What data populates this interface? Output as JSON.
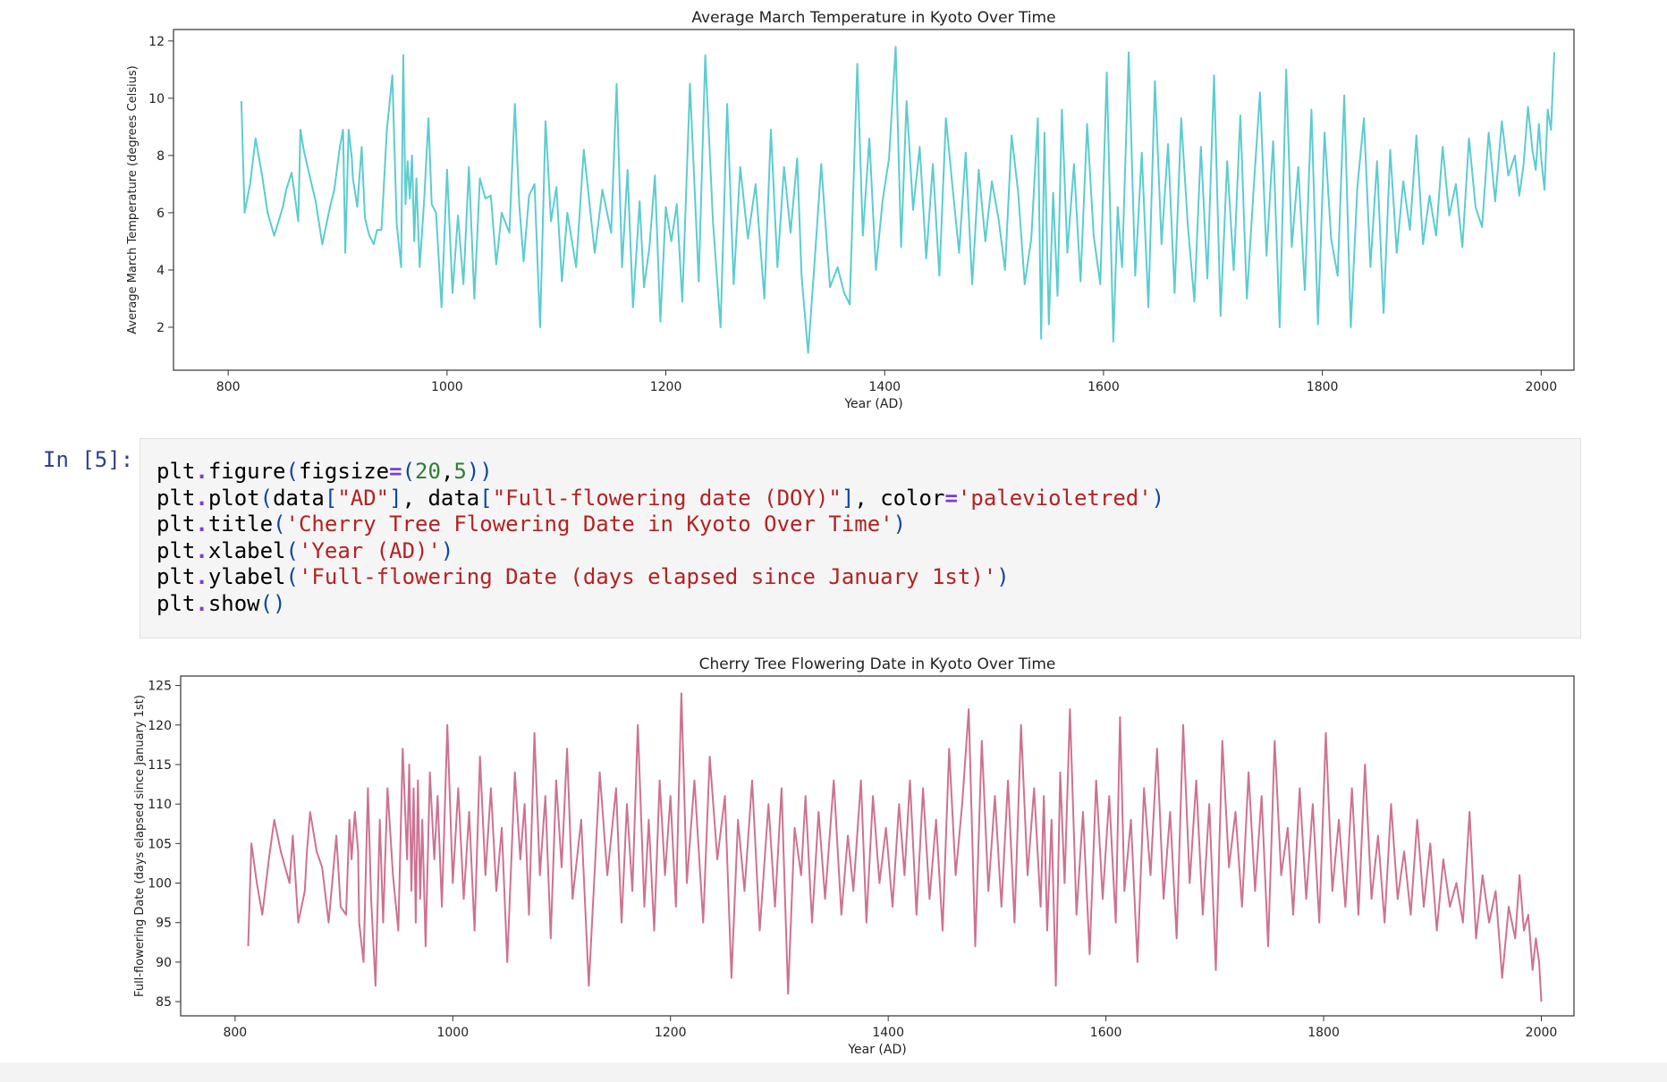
{
  "prompt": "In [5]:",
  "code_lines": [
    [
      {
        "t": "plt"
      },
      {
        "t": ".",
        "c": "op"
      },
      {
        "t": "figure"
      },
      {
        "t": "(",
        "c": "par"
      },
      {
        "t": "figsize"
      },
      {
        "t": "=",
        "c": "op"
      },
      {
        "t": "(",
        "c": "par"
      },
      {
        "t": "20",
        "c": "num"
      },
      {
        "t": ","
      },
      {
        "t": "5",
        "c": "num"
      },
      {
        "t": "))",
        "c": "par"
      }
    ],
    [
      {
        "t": "plt"
      },
      {
        "t": ".",
        "c": "op"
      },
      {
        "t": "plot"
      },
      {
        "t": "(",
        "c": "par"
      },
      {
        "t": "data"
      },
      {
        "t": "[",
        "c": "par"
      },
      {
        "t": "\"AD\"",
        "c": "str"
      },
      {
        "t": "]",
        "c": "par"
      },
      {
        "t": ", data"
      },
      {
        "t": "[",
        "c": "par"
      },
      {
        "t": "\"Full-flowering date (DOY)\"",
        "c": "str"
      },
      {
        "t": "]",
        "c": "par"
      },
      {
        "t": ", color"
      },
      {
        "t": "=",
        "c": "op"
      },
      {
        "t": "'palevioletred'",
        "c": "str"
      },
      {
        "t": ")",
        "c": "par"
      }
    ],
    [
      {
        "t": "plt"
      },
      {
        "t": ".",
        "c": "op"
      },
      {
        "t": "title"
      },
      {
        "t": "(",
        "c": "par"
      },
      {
        "t": "'Cherry Tree Flowering Date in Kyoto Over Time'",
        "c": "str"
      },
      {
        "t": ")",
        "c": "par"
      }
    ],
    [
      {
        "t": "plt"
      },
      {
        "t": ".",
        "c": "op"
      },
      {
        "t": "xlabel"
      },
      {
        "t": "(",
        "c": "par"
      },
      {
        "t": "'Year (AD)'",
        "c": "str"
      },
      {
        "t": ")",
        "c": "par"
      }
    ],
    [
      {
        "t": "plt"
      },
      {
        "t": ".",
        "c": "op"
      },
      {
        "t": "ylabel"
      },
      {
        "t": "(",
        "c": "par"
      },
      {
        "t": "'Full-flowering Date (days elapsed since January 1st)'",
        "c": "str"
      },
      {
        "t": ")",
        "c": "par"
      }
    ],
    [
      {
        "t": "plt"
      },
      {
        "t": ".",
        "c": "op"
      },
      {
        "t": "show"
      },
      {
        "t": "()",
        "c": "par"
      }
    ]
  ],
  "colors": {
    "line1": "#5ccccf",
    "line2": "#cc7293",
    "axes": "#333333",
    "text": "#222222"
  },
  "chart_data": [
    {
      "type": "line",
      "title": "Average March Temperature in Kyoto Over Time",
      "xlabel": "Year (AD)",
      "ylabel": "Average March Temperature (degrees Celsius)",
      "xlim": [
        750,
        2030
      ],
      "ylim": [
        0.5,
        12.4
      ],
      "xticks": [
        800,
        1000,
        1200,
        1400,
        1600,
        1800,
        2000
      ],
      "yticks": [
        2,
        4,
        6,
        8,
        10,
        12
      ],
      "color": "#5ccccf",
      "x": [
        812,
        815,
        820,
        825,
        831,
        836,
        842,
        850,
        853,
        858,
        864,
        866,
        869,
        875,
        880,
        886,
        893,
        897,
        902,
        905,
        907,
        910,
        913,
        914,
        918,
        922,
        925,
        929,
        933,
        936,
        940,
        945,
        950,
        954,
        958,
        960,
        962,
        964,
        966,
        968,
        970,
        972,
        975,
        979,
        983,
        986,
        990,
        995,
        1000,
        1005,
        1010,
        1015,
        1020,
        1025,
        1030,
        1035,
        1040,
        1045,
        1050,
        1057,
        1062,
        1066,
        1070,
        1075,
        1080,
        1085,
        1090,
        1095,
        1100,
        1105,
        1110,
        1118,
        1125,
        1135,
        1142,
        1150,
        1155,
        1160,
        1165,
        1170,
        1176,
        1180,
        1185,
        1190,
        1195,
        1200,
        1205,
        1210,
        1215,
        1222,
        1230,
        1236,
        1243,
        1250,
        1256,
        1262,
        1268,
        1275,
        1282,
        1290,
        1296,
        1302,
        1308,
        1314,
        1320,
        1324,
        1330,
        1336,
        1342,
        1350,
        1357,
        1363,
        1368,
        1375,
        1380,
        1386,
        1392,
        1398,
        1404,
        1410,
        1415,
        1420,
        1426,
        1432,
        1438,
        1444,
        1450,
        1456,
        1462,
        1468,
        1474,
        1480,
        1486,
        1492,
        1498,
        1504,
        1510,
        1516,
        1522,
        1528,
        1534,
        1540,
        1543,
        1546,
        1550,
        1554,
        1558,
        1562,
        1567,
        1573,
        1579,
        1585,
        1591,
        1597,
        1603,
        1609,
        1613,
        1617,
        1623,
        1629,
        1635,
        1641,
        1647,
        1653,
        1659,
        1665,
        1671,
        1677,
        1683,
        1689,
        1695,
        1701,
        1707,
        1713,
        1719,
        1725,
        1731,
        1737,
        1743,
        1749,
        1755,
        1761,
        1767,
        1772,
        1778,
        1784,
        1790,
        1796,
        1802,
        1808,
        1814,
        1820,
        1826,
        1832,
        1838,
        1844,
        1850,
        1856,
        1862,
        1868,
        1874,
        1880,
        1886,
        1892,
        1898,
        1904,
        1910,
        1916,
        1922,
        1928,
        1934,
        1940,
        1946,
        1952,
        1958,
        1964,
        1970,
        1976,
        1980,
        1984,
        1988,
        1992,
        1995,
        1998,
        2000,
        2003,
        2006,
        2009,
        2012,
        2015,
        2018,
        2021
      ],
      "y": [
        9.9,
        6.0,
        7.0,
        8.6,
        7.3,
        6.0,
        5.2,
        6.2,
        6.8,
        7.4,
        5.7,
        8.9,
        8.2,
        7.2,
        6.4,
        4.9,
        6.2,
        6.8,
        8.3,
        8.9,
        4.6,
        8.9,
        7.9,
        7.2,
        6.2,
        8.3,
        5.8,
        5.2,
        4.9,
        5.4,
        5.4,
        8.9,
        10.8,
        5.6,
        4.1,
        11.5,
        6.3,
        7.8,
        6.5,
        8.0,
        5.0,
        7.2,
        4.1,
        6.4,
        9.3,
        6.3,
        6.0,
        2.7,
        7.5,
        3.2,
        5.9,
        3.5,
        7.6,
        3.0,
        7.2,
        6.5,
        6.6,
        4.2,
        6.0,
        5.3,
        9.8,
        6.3,
        4.3,
        6.6,
        7.0,
        2.0,
        9.2,
        5.7,
        6.9,
        3.6,
        6.0,
        4.1,
        8.2,
        4.6,
        6.8,
        5.3,
        10.5,
        4.1,
        7.5,
        2.7,
        6.4,
        3.4,
        4.8,
        7.3,
        2.2,
        6.2,
        5.0,
        6.3,
        2.9,
        10.5,
        3.6,
        11.5,
        5.7,
        2.0,
        9.8,
        3.5,
        7.6,
        5.1,
        7.0,
        3.0,
        8.9,
        4.1,
        7.6,
        5.3,
        7.9,
        3.8,
        1.1,
        4.3,
        7.7,
        3.4,
        4.1,
        3.2,
        2.8,
        11.2,
        5.2,
        8.6,
        4.0,
        6.4,
        7.9,
        11.8,
        4.8,
        9.9,
        6.1,
        8.3,
        4.4,
        7.7,
        3.8,
        9.3,
        6.9,
        4.6,
        8.1,
        3.5,
        7.5,
        5.0,
        7.1,
        5.8,
        4.0,
        8.7,
        6.7,
        3.5,
        5.1,
        9.3,
        1.6,
        8.8,
        2.1,
        6.7,
        3.1,
        9.6,
        4.6,
        7.7,
        3.6,
        9.1,
        5.2,
        3.5,
        10.9,
        1.5,
        6.2,
        4.1,
        11.6,
        3.8,
        8.1,
        2.7,
        10.6,
        4.9,
        8.4,
        3.2,
        9.3,
        5.6,
        2.9,
        8.3,
        3.7,
        10.8,
        2.4,
        7.8,
        4.0,
        9.4,
        3.0,
        6.7,
        10.2,
        4.5,
        8.5,
        2.0,
        11.0,
        4.8,
        7.6,
        3.3,
        9.6,
        2.1,
        8.8,
        5.1,
        3.8,
        10.1,
        2.0,
        6.9,
        9.3,
        4.1,
        7.8,
        2.5,
        8.2,
        4.6,
        7.1,
        5.4,
        8.7,
        4.9,
        6.6,
        5.2,
        8.3,
        5.9,
        7.0,
        4.8,
        8.6,
        6.2,
        5.5,
        8.8,
        6.4,
        9.2,
        7.3,
        8.0,
        6.6,
        7.7,
        9.7,
        8.2,
        7.5,
        9.1,
        7.9,
        6.8,
        9.6,
        8.9,
        11.6
      ]
    },
    {
      "type": "line",
      "title": "Cherry Tree Flowering Date in Kyoto Over Time",
      "xlabel": "Year (AD)",
      "ylabel": "Full-flowering Date (days elapsed since January 1st)",
      "xlim": [
        750,
        2030
      ],
      "ylim": [
        83.2,
        126.2
      ],
      "xticks": [
        800,
        1000,
        1200,
        1400,
        1600,
        1800,
        2000
      ],
      "yticks": [
        85,
        90,
        95,
        100,
        105,
        110,
        115,
        120,
        125
      ],
      "color": "#cc7293",
      "x": [
        812,
        815,
        820,
        825,
        831,
        836,
        842,
        850,
        853,
        858,
        864,
        866,
        869,
        875,
        880,
        886,
        893,
        897,
        902,
        905,
        907,
        910,
        913,
        914,
        918,
        922,
        925,
        929,
        933,
        936,
        940,
        945,
        950,
        954,
        958,
        960,
        962,
        964,
        966,
        968,
        970,
        972,
        975,
        979,
        983,
        986,
        990,
        995,
        1000,
        1005,
        1010,
        1015,
        1020,
        1025,
        1030,
        1035,
        1040,
        1045,
        1050,
        1057,
        1062,
        1066,
        1070,
        1075,
        1080,
        1085,
        1090,
        1095,
        1100,
        1105,
        1110,
        1118,
        1125,
        1135,
        1142,
        1150,
        1155,
        1160,
        1165,
        1170,
        1176,
        1180,
        1185,
        1190,
        1195,
        1200,
        1205,
        1210,
        1215,
        1222,
        1230,
        1236,
        1243,
        1250,
        1256,
        1262,
        1268,
        1275,
        1282,
        1290,
        1296,
        1302,
        1308,
        1314,
        1320,
        1324,
        1330,
        1336,
        1342,
        1350,
        1357,
        1363,
        1368,
        1375,
        1380,
        1386,
        1392,
        1398,
        1404,
        1410,
        1415,
        1420,
        1426,
        1432,
        1438,
        1444,
        1450,
        1456,
        1462,
        1468,
        1474,
        1480,
        1486,
        1492,
        1498,
        1504,
        1510,
        1516,
        1522,
        1528,
        1534,
        1540,
        1543,
        1546,
        1550,
        1554,
        1558,
        1562,
        1567,
        1573,
        1579,
        1585,
        1591,
        1597,
        1603,
        1609,
        1613,
        1617,
        1623,
        1629,
        1635,
        1641,
        1647,
        1653,
        1659,
        1665,
        1671,
        1677,
        1683,
        1689,
        1695,
        1701,
        1707,
        1713,
        1719,
        1725,
        1731,
        1737,
        1743,
        1749,
        1755,
        1761,
        1767,
        1772,
        1778,
        1784,
        1790,
        1796,
        1802,
        1808,
        1814,
        1820,
        1826,
        1832,
        1838,
        1844,
        1850,
        1856,
        1862,
        1868,
        1874,
        1880,
        1886,
        1892,
        1898,
        1904,
        1910,
        1916,
        1922,
        1928,
        1934,
        1940,
        1946,
        1952,
        1958,
        1964,
        1970,
        1976,
        1980,
        1984,
        1988,
        1992,
        1995,
        1998,
        2000,
        2003,
        2006,
        2009,
        2012,
        2015,
        2018,
        2021
      ],
      "y": [
        92,
        105,
        100,
        96,
        103,
        108,
        104,
        100,
        106,
        95,
        99,
        104,
        109,
        104,
        102,
        95,
        106,
        97,
        96,
        108,
        103,
        109,
        104,
        95,
        90,
        112,
        98,
        87,
        108,
        95,
        112,
        101,
        94,
        117,
        103,
        115,
        99,
        112,
        95,
        113,
        98,
        108,
        92,
        114,
        103,
        111,
        97,
        120,
        100,
        112,
        98,
        109,
        94,
        116,
        101,
        112,
        99,
        107,
        90,
        114,
        103,
        110,
        96,
        119,
        101,
        111,
        93,
        113,
        102,
        117,
        98,
        108,
        87,
        114,
        101,
        112,
        95,
        110,
        99,
        120,
        97,
        108,
        94,
        113,
        101,
        111,
        97,
        124,
        100,
        113,
        95,
        116,
        103,
        111,
        88,
        108,
        99,
        113,
        94,
        110,
        97,
        112,
        86,
        107,
        101,
        111,
        95,
        109,
        98,
        113,
        96,
        106,
        99,
        113,
        95,
        111,
        100,
        107,
        97,
        110,
        101,
        113,
        96,
        112,
        98,
        108,
        94,
        117,
        101,
        110,
        122,
        92,
        118,
        99,
        111,
        97,
        113,
        95,
        120,
        101,
        112,
        97,
        111,
        94,
        108,
        87,
        114,
        100,
        122,
        96,
        109,
        91,
        113,
        98,
        111,
        95,
        121,
        99,
        108,
        90,
        112,
        101,
        117,
        98,
        109,
        93,
        120,
        100,
        113,
        96,
        110,
        89,
        118,
        102,
        109,
        97,
        114,
        99,
        111,
        92,
        118,
        101,
        107,
        96,
        112,
        98,
        110,
        95,
        119,
        99,
        108,
        97,
        112,
        96,
        115,
        98,
        106,
        95,
        110,
        98,
        104,
        96,
        108,
        97,
        105,
        94,
        103,
        97,
        100,
        95,
        109,
        93,
        101,
        95,
        99,
        88,
        97,
        93,
        101,
        94,
        96,
        89,
        93,
        90,
        85
      ]
    }
  ]
}
